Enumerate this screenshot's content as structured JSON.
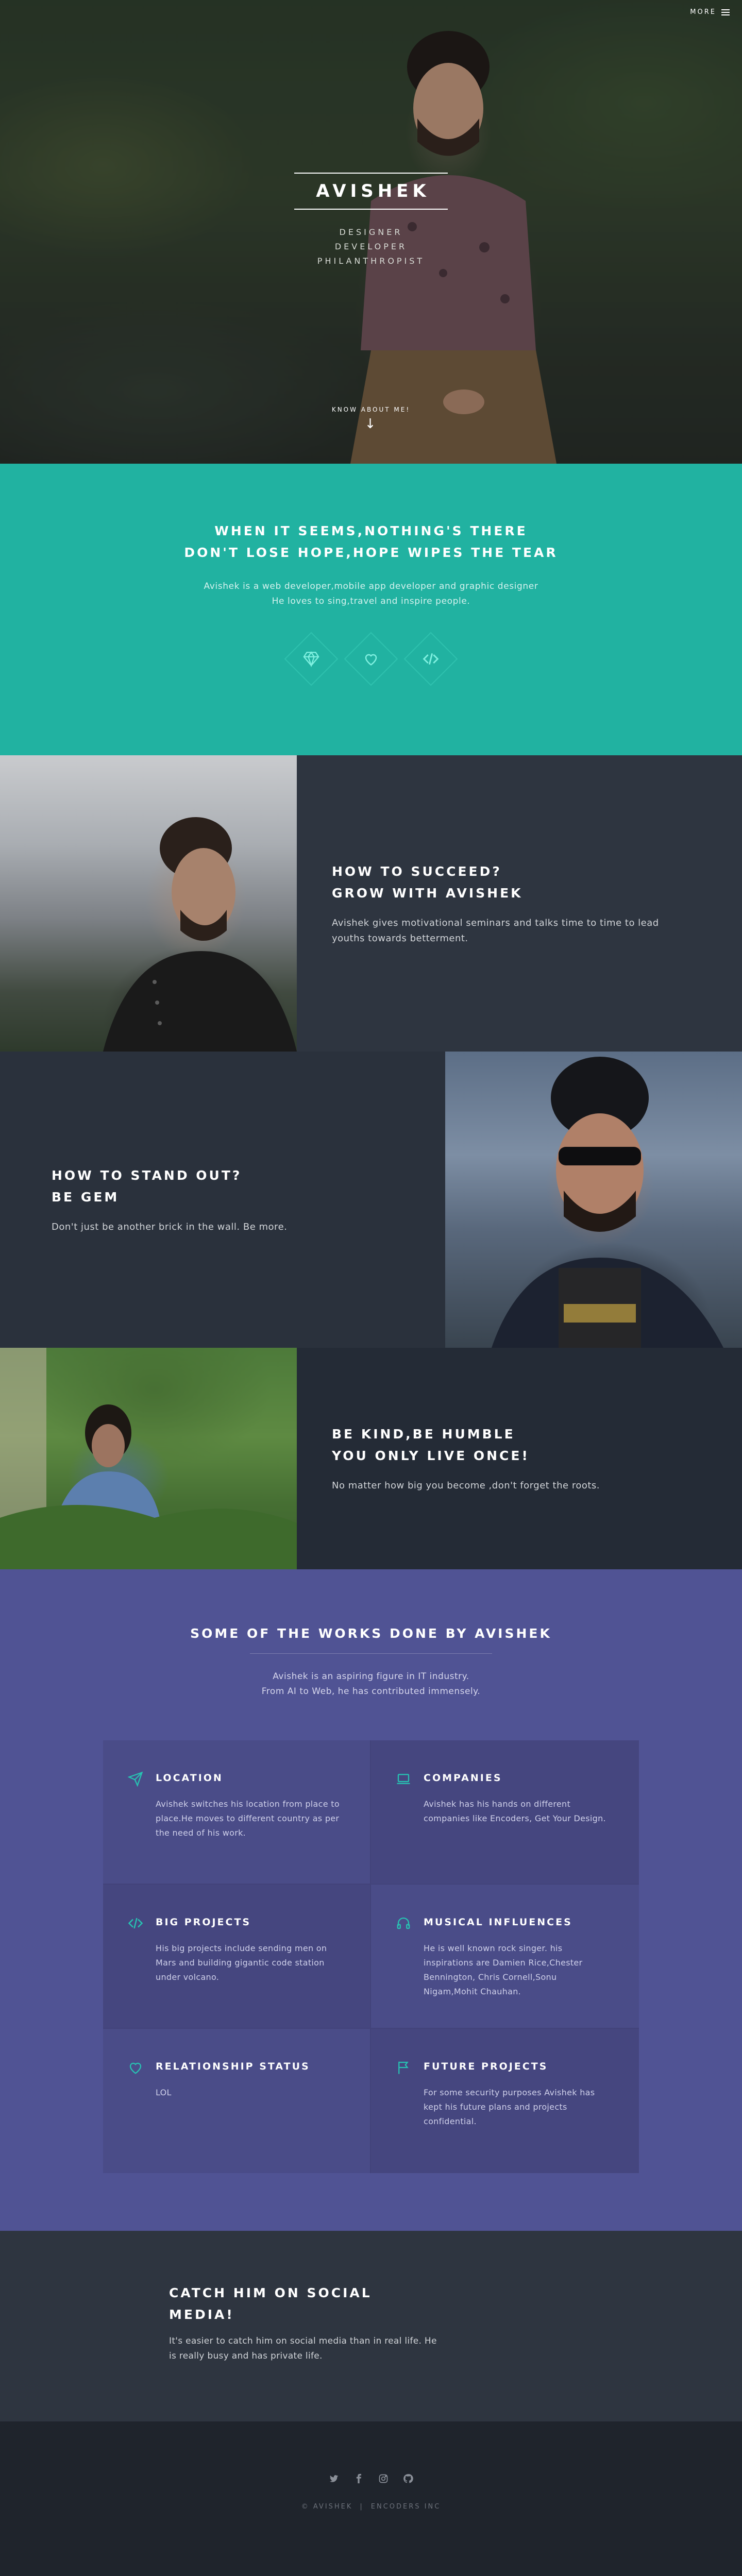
{
  "header": {
    "more_label": "MORE"
  },
  "hero": {
    "title": "AVISHEK",
    "roles": [
      "DESIGNER",
      "DEVELOPER",
      "PHILANTHROPIST"
    ],
    "cta": "KNOW ABOUT ME!"
  },
  "intro": {
    "heading": [
      "WHEN IT SEEMS,NOTHING'S THERE",
      "DON'T LOSE HOPE,HOPE WIPES THE TEAR"
    ],
    "text": [
      "Avishek is a web developer,mobile app developer and graphic designer",
      "He loves to sing,travel and inspire people."
    ],
    "icons": [
      "diamond-icon",
      "heart-icon",
      "code-icon"
    ],
    "accent": "#21b2a1"
  },
  "sections": [
    {
      "title": [
        "HOW TO SUCCEED?",
        "GROW WITH AVISHEK"
      ],
      "text": "Avishek gives motivational seminars and talks time to time to lead youths towards betterment."
    },
    {
      "title": [
        "HOW TO STAND OUT?",
        "BE GEM"
      ],
      "text": "Don't just be another brick in the wall. Be more."
    },
    {
      "title": [
        "BE KIND,BE HUMBLE",
        "YOU ONLY LIVE ONCE!"
      ],
      "text": "No matter how big you become ,don't forget the roots."
    }
  ],
  "works": {
    "heading": "SOME OF THE WORKS DONE BY AVISHEK",
    "desc": [
      "Avishek is an aspiring figure in IT industry.",
      "From AI to Web, he has contributed immensely."
    ],
    "features": [
      {
        "icon": "paper-plane-icon",
        "title": "LOCATION",
        "text": "Avishek switches his location from place to place.He moves to different country as per the need of his work."
      },
      {
        "icon": "laptop-icon",
        "title": "COMPANIES",
        "text": "Avishek has his hands on different companies like Encoders, Get Your Design."
      },
      {
        "icon": "code-icon",
        "title": "BIG PROJECTS",
        "text": "His big projects include sending men on Mars and building gigantic code station under volcano."
      },
      {
        "icon": "headphones-icon",
        "title": "MUSICAL INFLUENCES",
        "text": "He is well known rock singer. his inspirations are Damien Rice,Chester Bennington, Chris Cornell,Sonu Nigam,Mohit Chauhan."
      },
      {
        "icon": "heart-icon",
        "title": "RELATIONSHIP STATUS",
        "text": "LOL"
      },
      {
        "icon": "flag-icon",
        "title": "FUTURE PROJECTS",
        "text": "For some security purposes Avishek has kept his future plans and projects confidential."
      }
    ],
    "accent": "#27c3b2"
  },
  "social": {
    "title": "CATCH HIM ON SOCIAL MEDIA!",
    "text": "It's easier to catch him on social media than in real life. He is really busy and has private life."
  },
  "footer": {
    "icons": [
      "twitter-icon",
      "facebook-icon",
      "instagram-icon",
      "github-icon"
    ],
    "copyright": "© AVISHEK",
    "company": "ENCODERS INC"
  }
}
